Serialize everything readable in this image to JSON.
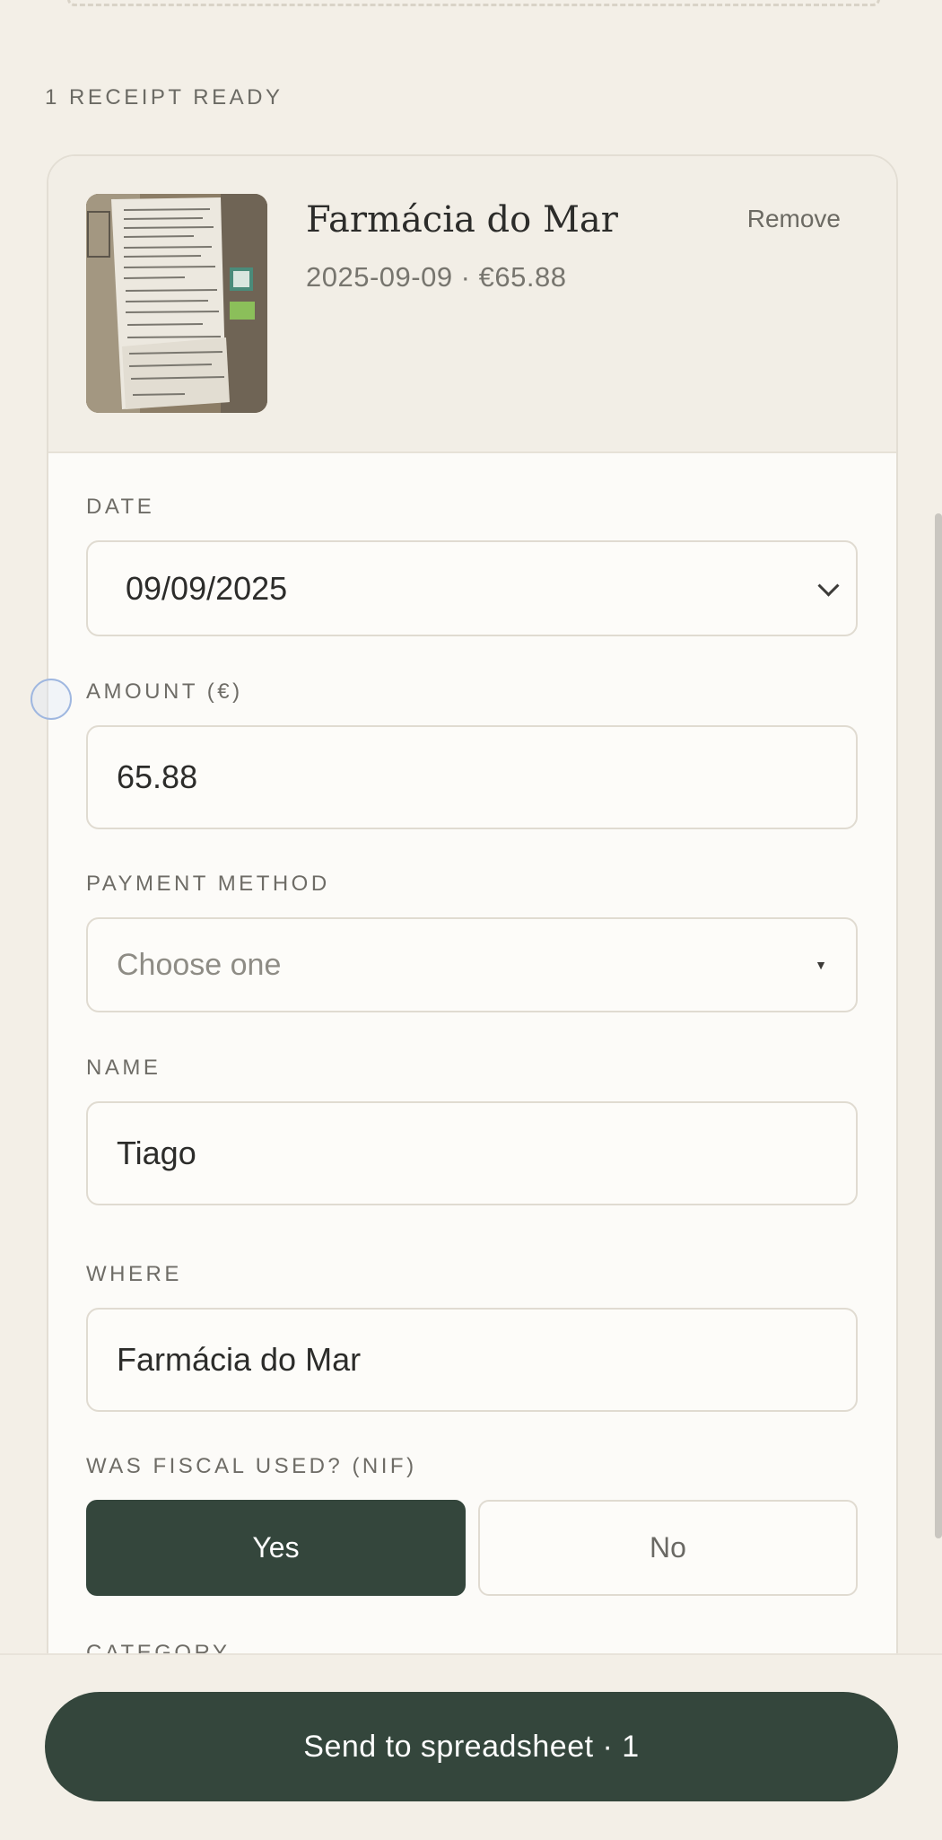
{
  "status": {
    "receipts_ready": "1 RECEIPT READY"
  },
  "receipt": {
    "title": "Farmácia do Mar",
    "subtitle": "2025-09-09 · €65.88",
    "remove_label": "Remove"
  },
  "form": {
    "date": {
      "label": "DATE",
      "value": "09/09/2025"
    },
    "amount": {
      "label": "AMOUNT (€)",
      "value": "65.88"
    },
    "payment_method": {
      "label": "PAYMENT METHOD",
      "placeholder": "Choose one"
    },
    "name": {
      "label": "NAME",
      "value": "Tiago"
    },
    "where": {
      "label": "WHERE",
      "value": "Farmácia do Mar"
    },
    "fiscal": {
      "label": "WAS FISCAL USED? (NIF)",
      "yes_label": "Yes",
      "no_label": "No",
      "selected": "Yes"
    },
    "category": {
      "label": "CATEGORY"
    }
  },
  "footer": {
    "send_label": "Send to spreadsheet · 1"
  },
  "colors": {
    "background": "#f3efe7",
    "accent": "#34463c",
    "card": "#fcfbf8"
  }
}
